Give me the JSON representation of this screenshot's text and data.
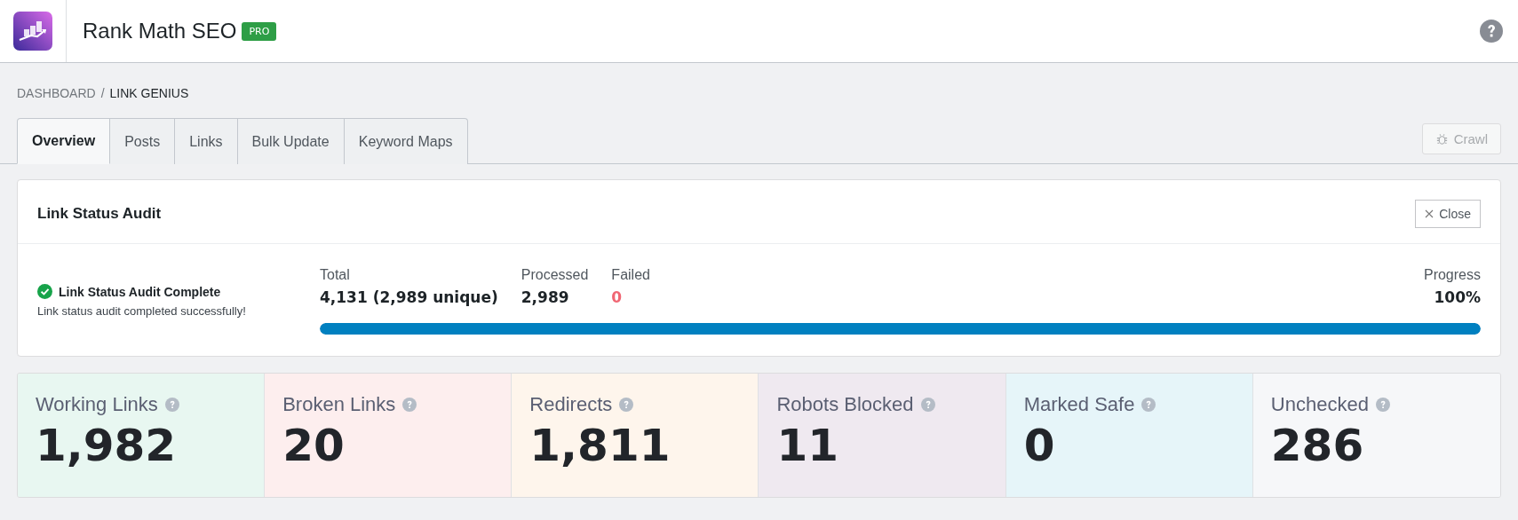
{
  "header": {
    "title": "Rank Math SEO",
    "badge": "PRO"
  },
  "breadcrumb_separator": "/",
  "breadcrumb": [
    {
      "label": "DASHBOARD",
      "current": false
    },
    {
      "label": "LINK GENIUS",
      "current": true
    }
  ],
  "tabs": [
    {
      "label": "Overview",
      "selected": true
    },
    {
      "label": "Posts",
      "selected": false
    },
    {
      "label": "Links",
      "selected": false
    },
    {
      "label": "Bulk Update",
      "selected": false
    },
    {
      "label": "Keyword Maps",
      "selected": false
    }
  ],
  "crawl_button": {
    "label": "Crawl",
    "disabled": true
  },
  "audit": {
    "title": "Link Status Audit",
    "close_label": "Close",
    "status_title": "Link Status Audit Complete",
    "status_text": "Link status audit completed successfully!",
    "metrics": [
      {
        "label": "Total",
        "value": "4,131 (2,989 unique)",
        "kind": "plain"
      },
      {
        "label": "Processed",
        "value": "2,989",
        "kind": "plain"
      },
      {
        "label": "Failed",
        "value": "0",
        "kind": "alert"
      }
    ],
    "progress": {
      "label": "Progress",
      "value": "100%",
      "level": 1
    }
  },
  "stats": [
    {
      "label": "Working Links",
      "value": "1,982",
      "color": "#e8f7f1"
    },
    {
      "label": "Broken Links",
      "value": "20",
      "color": "#fdeeee"
    },
    {
      "label": "Redirects",
      "value": "1,811",
      "color": "#fef5ec"
    },
    {
      "label": "Robots Blocked",
      "value": "11",
      "color": "#efe9f0"
    },
    {
      "label": "Marked Safe",
      "value": "0",
      "color": "#e6f5f9"
    },
    {
      "label": "Unchecked",
      "value": "286",
      "color": "#f6f7f9"
    }
  ]
}
